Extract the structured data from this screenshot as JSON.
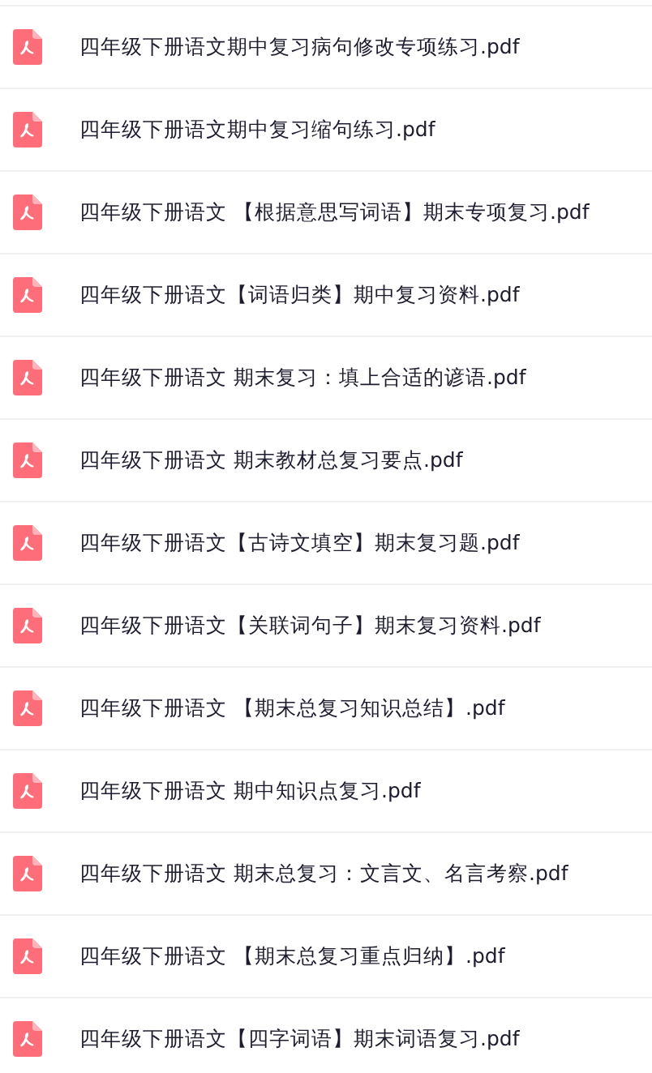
{
  "files": [
    {
      "name": "四年级下册语文期中复习病句修改专项练习.pdf"
    },
    {
      "name": "四年级下册语文期中复习缩句练习.pdf"
    },
    {
      "name": "四年级下册语文 【根据意思写词语】期末专项复习.pdf"
    },
    {
      "name": "四年级下册语文【词语归类】期中复习资料.pdf"
    },
    {
      "name": "四年级下册语文 期末复习：填上合适的谚语.pdf"
    },
    {
      "name": "四年级下册语文 期末教材总复习要点.pdf"
    },
    {
      "name": "四年级下册语文【古诗文填空】期末复习题.pdf"
    },
    {
      "name": "四年级下册语文【关联词句子】期末复习资料.pdf"
    },
    {
      "name": "四年级下册语文 【期末总复习知识总结】.pdf"
    },
    {
      "name": "四年级下册语文 期中知识点复习.pdf"
    },
    {
      "name": "四年级下册语文 期末总复习：文言文、名言考察.pdf"
    },
    {
      "name": "四年级下册语文 【期末总复习重点归纳】.pdf"
    },
    {
      "name": "四年级下册语文【四字词语】期末词语复习.pdf"
    }
  ]
}
